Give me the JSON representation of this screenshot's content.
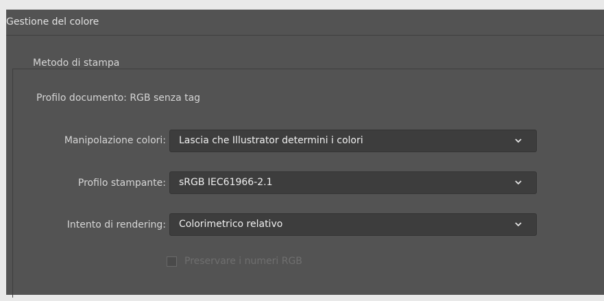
{
  "header": {
    "title": "Gestione del colore"
  },
  "print_method": {
    "title": "Metodo di stampa",
    "document_profile": {
      "label": "Profilo documento:",
      "value": "RGB senza tag"
    },
    "color_handling": {
      "label": "Manipolazione colori:",
      "value": "Lascia che Illustrator determini i colori"
    },
    "printer_profile": {
      "label": "Profilo stampante:",
      "value": "sRGB IEC61966-2.1"
    },
    "rendering_intent": {
      "label": "Intento di rendering:",
      "value": "Colorimetrico relativo"
    },
    "preserve_rgb": {
      "label": "Preservare i numeri RGB",
      "checked": false,
      "enabled": false
    }
  },
  "icons": {
    "dropdown": "chevron-down-icon"
  },
  "colors": {
    "panel_bg": "#535353",
    "field_bg": "#3d3d3d",
    "text": "#d6d6d6",
    "disabled_text": "#6f6f6f"
  }
}
